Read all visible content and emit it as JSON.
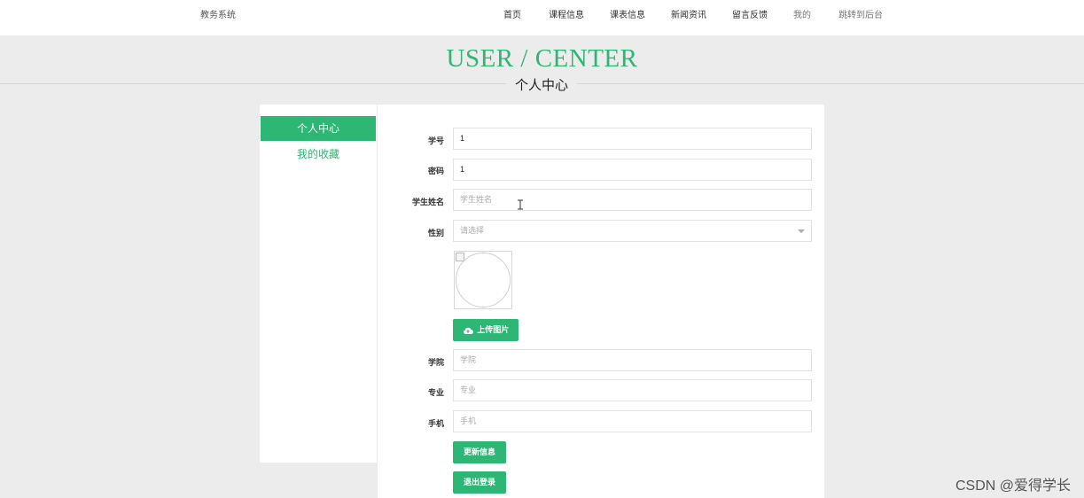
{
  "header": {
    "brand": "教务系统",
    "nav": [
      {
        "label": "首页"
      },
      {
        "label": "课程信息"
      },
      {
        "label": "课表信息"
      },
      {
        "label": "新闻资讯"
      },
      {
        "label": "留言反馈"
      },
      {
        "label": "我的"
      },
      {
        "label": "跳转到后台"
      }
    ]
  },
  "hero": {
    "title": "USER / CENTER",
    "subtitle": "个人中心"
  },
  "sidebar": {
    "items": [
      {
        "label": "个人中心",
        "active": true
      },
      {
        "label": "我的收藏",
        "active": false
      }
    ]
  },
  "form": {
    "student_id": {
      "label": "学号",
      "value": "1"
    },
    "password": {
      "label": "密码",
      "value": "1"
    },
    "student_name": {
      "label": "学生姓名",
      "placeholder": "学生姓名"
    },
    "gender": {
      "label": "性别",
      "placeholder": "请选择"
    },
    "upload_button": "上传图片",
    "college": {
      "label": "学院",
      "placeholder": "学院"
    },
    "major": {
      "label": "专业",
      "placeholder": "专业"
    },
    "phone": {
      "label": "手机",
      "placeholder": "手机"
    },
    "update_button": "更新信息",
    "logout_button": "退出登录"
  },
  "watermark": "CSDN @爱得学长",
  "colors": {
    "accent": "#2db674",
    "background": "#ececec",
    "panel": "#ffffff"
  }
}
